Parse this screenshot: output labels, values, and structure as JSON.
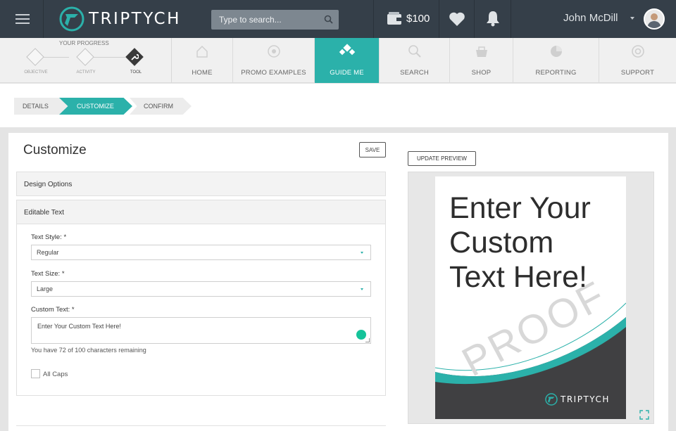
{
  "header": {
    "brand": "TRIPTYCH",
    "search_placeholder": "Type to search...",
    "balance": "$100",
    "user_name": "John McDill"
  },
  "progress": {
    "title": "YOUR PROGRESS",
    "steps": [
      {
        "label": "OBJECTIVE"
      },
      {
        "label": "ACTIVITY"
      },
      {
        "label": "TOOL"
      }
    ]
  },
  "nav": {
    "items": [
      {
        "label": "HOME"
      },
      {
        "label": "PROMO EXAMPLES"
      },
      {
        "label": "GUIDE ME"
      },
      {
        "label": "SEARCH"
      },
      {
        "label": "SHOP"
      },
      {
        "label": "REPORTING"
      },
      {
        "label": "SUPPORT"
      }
    ],
    "active": "GUIDE ME"
  },
  "breadcrumb": [
    "DETAILS",
    "CUSTOMIZE",
    "CONFIRM"
  ],
  "form": {
    "title": "Customize",
    "save_label": "SAVE",
    "design_options": "Design Options",
    "editable_text": "Editable Text",
    "text_style_label": "Text Style: *",
    "text_style_value": "Regular",
    "text_size_label": "Text Size: *",
    "text_size_value": "Large",
    "custom_text_label": "Custom Text: *",
    "custom_text_value": "Enter Your Custom Text Here!",
    "remaining": "You have 72 of 100 characters remaining",
    "all_caps": "All Caps"
  },
  "preview": {
    "update_label": "UPDATE PREVIEW",
    "poster_text": "Enter Your\nCustom\nText Here!",
    "watermark": "PROOF",
    "brand": "TRIPTYCH"
  },
  "colors": {
    "accent": "#2bb1aa",
    "topbar": "#353f49"
  }
}
